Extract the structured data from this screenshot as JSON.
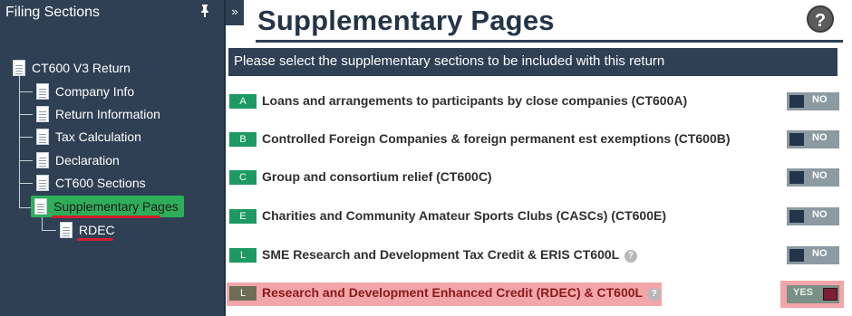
{
  "sidebar": {
    "title": "Filing Sections",
    "collapse_glyph": "»",
    "tree": {
      "root": "CT600 V3 Return",
      "children": [
        "Company Info",
        "Return Information",
        "Tax Calculation",
        "Declaration",
        "CT600 Sections",
        "Supplementary Pages"
      ],
      "grandchild": "RDEC"
    },
    "active_item": "Supplementary Pages"
  },
  "main": {
    "title": "Supplementary Pages",
    "help_glyph": "?",
    "banner": "Please select the supplementary sections to be included with this return",
    "rows": [
      {
        "letter": "A",
        "label": "Loans and arrangements to participants by close companies (CT600A)",
        "value": "NO"
      },
      {
        "letter": "B",
        "label": "Controlled Foreign Companies & foreign permanent est exemptions (CT600B)",
        "value": "NO"
      },
      {
        "letter": "C",
        "label": "Group and consortium relief (CT600C)",
        "value": "NO"
      },
      {
        "letter": "E",
        "label": "Charities and Community Amateur Sports Clubs (CASCs) (CT600E)",
        "value": "NO"
      },
      {
        "letter": "L",
        "label": "SME Research and Development Tax Credit & ERIS CT600L",
        "value": "NO"
      },
      {
        "letter": "L",
        "label": "Research and Development Enhanced Credit (RDEC) & CT600L",
        "value": "YES"
      }
    ]
  },
  "colors": {
    "sidebar_bg": "#2f4055",
    "accent_green": "#1d9a63",
    "active_node": "#2fae5a",
    "highlight_red": "#f2a6aa",
    "underline_red": "#d01f2e"
  }
}
